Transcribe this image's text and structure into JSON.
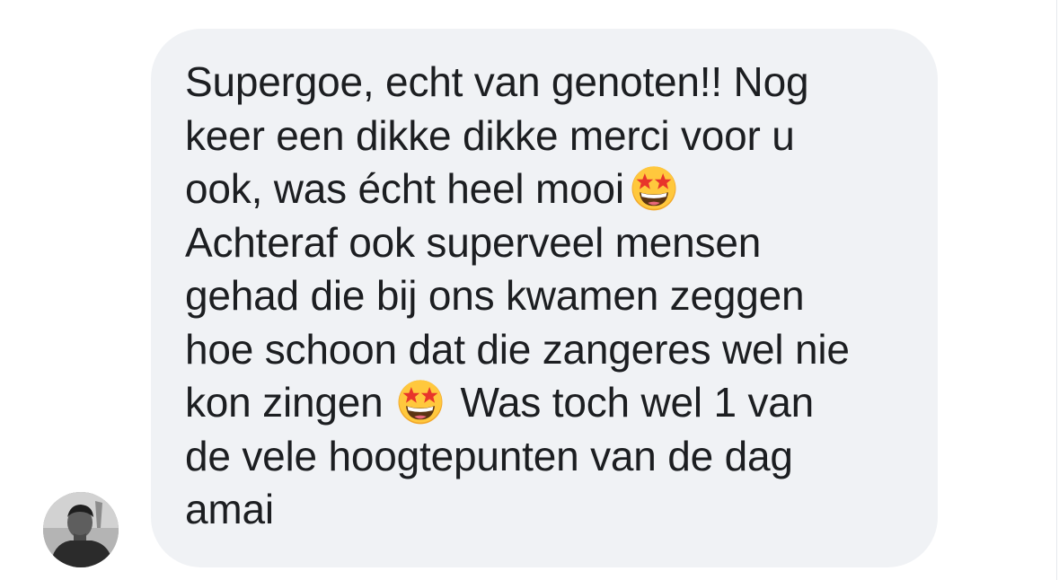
{
  "message": {
    "lines": [
      {
        "text": "Supergoe, echt van genoten!! Nog"
      },
      {
        "text": "keer een dikke dikke merci voor u"
      },
      {
        "text": "ook, was écht heel mooi",
        "emoji_after": "star-struck-emoji-icon"
      },
      {
        "text": "Achteraf ook superveel mensen"
      },
      {
        "text": "gehad die bij ons kwamen zeggen"
      },
      {
        "text": "hoe schoon dat die zangeres wel nie"
      },
      {
        "text": "kon zingen",
        "emoji_after": "star-struck-emoji-icon",
        "text_after": "Was toch wel 1 van"
      },
      {
        "text": "de vele hoogtepunten van de dag"
      },
      {
        "text": "amai"
      }
    ]
  },
  "sender": {
    "avatar": "avatar-photo"
  },
  "colors": {
    "bubble_background": "#f0f2f5",
    "text": "#1c1e21",
    "emoji_face": "#ffc83d"
  }
}
